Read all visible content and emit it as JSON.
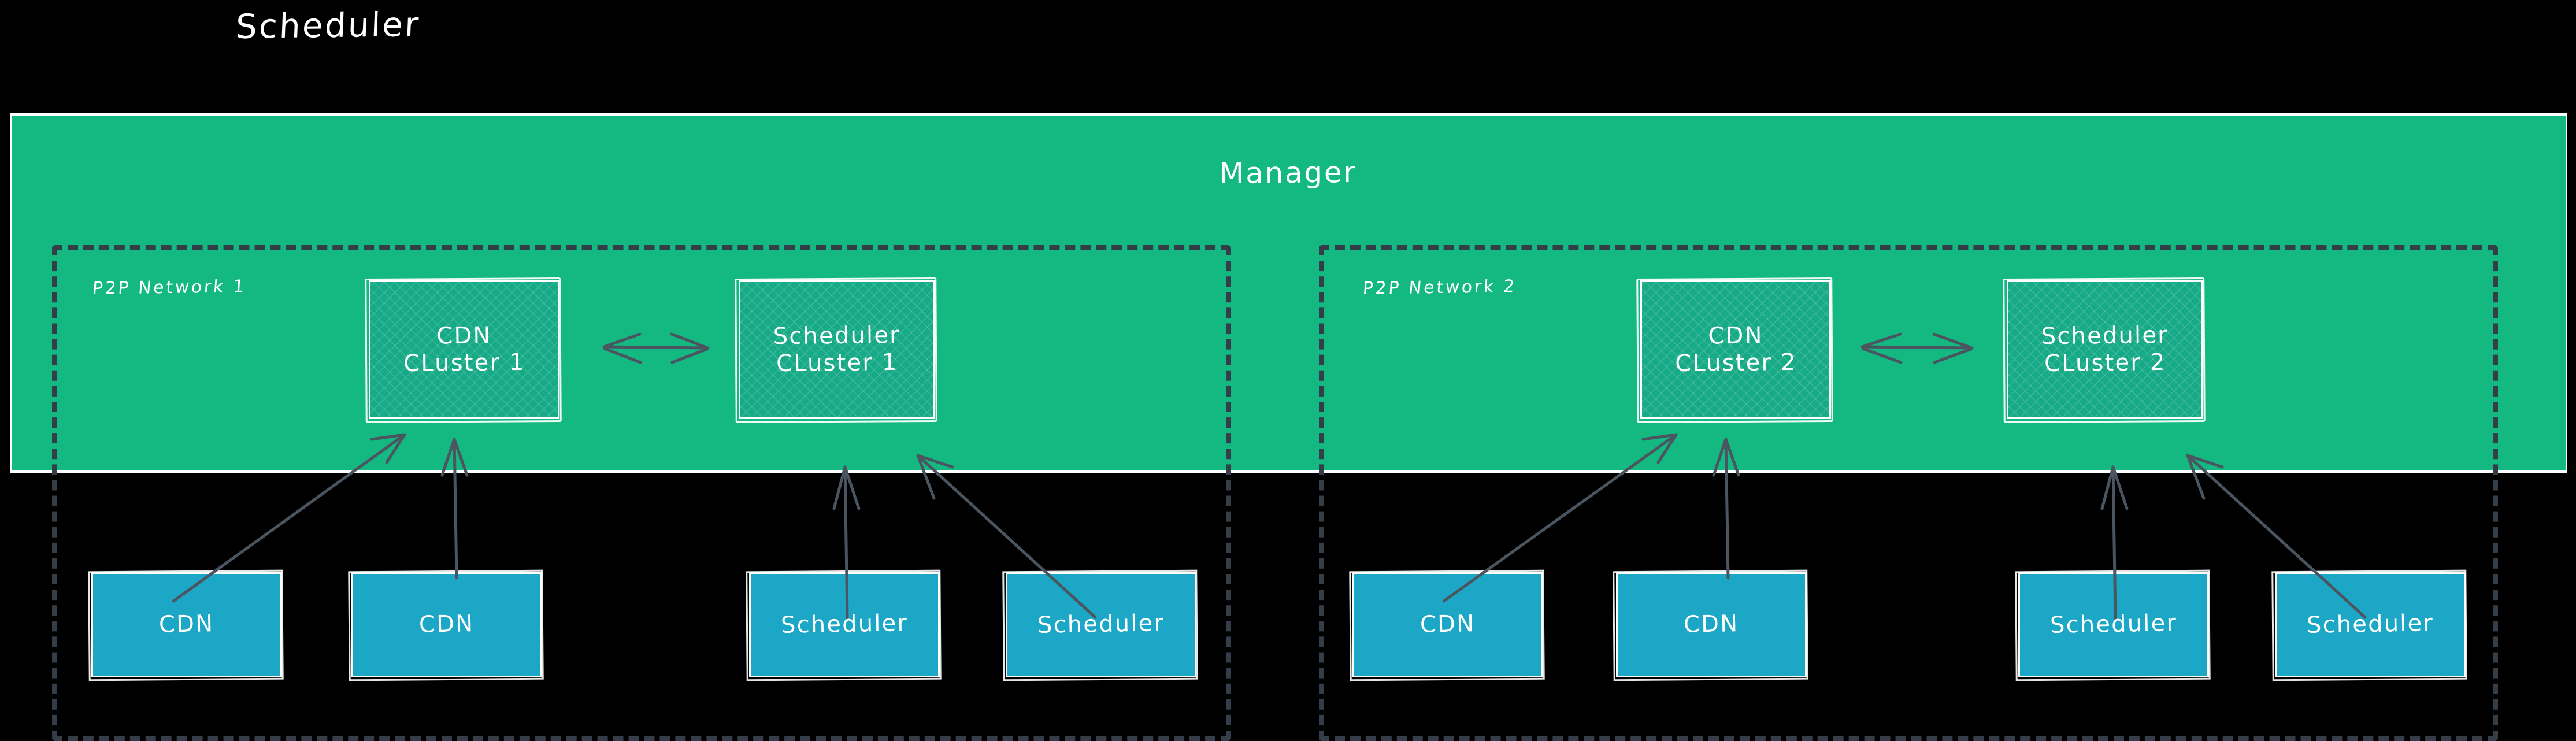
{
  "title": "Scheduler",
  "manager": {
    "label": "Manager",
    "color": "#14B881"
  },
  "networks": [
    {
      "label": "P2P Network 1",
      "clusters": [
        {
          "name": "cdn-cluster-1",
          "label": "CDN\nCLuster 1"
        },
        {
          "name": "scheduler-cluster-1",
          "label": "Scheduler\nCLuster 1"
        }
      ],
      "nodes": [
        {
          "name": "cdn-node-1a",
          "label": "CDN"
        },
        {
          "name": "cdn-node-1b",
          "label": "CDN"
        },
        {
          "name": "scheduler-node-1a",
          "label": "Scheduler"
        },
        {
          "name": "scheduler-node-1b",
          "label": "Scheduler"
        }
      ]
    },
    {
      "label": "P2P Network 2",
      "clusters": [
        {
          "name": "cdn-cluster-2",
          "label": "CDN\nCLuster 2"
        },
        {
          "name": "scheduler-cluster-2",
          "label": "Scheduler\nCLuster 2"
        }
      ],
      "nodes": [
        {
          "name": "cdn-node-2a",
          "label": "CDN"
        },
        {
          "name": "cdn-node-2b",
          "label": "CDN"
        },
        {
          "name": "scheduler-node-2a",
          "label": "Scheduler"
        },
        {
          "name": "scheduler-node-2b",
          "label": "Scheduler"
        }
      ]
    }
  ],
  "colors": {
    "background": "#000000",
    "manager_green": "#14B881",
    "cluster_fill": "#16AA86",
    "node_blue": "#1CA7C6",
    "dashed_border": "#333E48",
    "arrow": "#4A5560",
    "text": "#FFFFFF"
  }
}
